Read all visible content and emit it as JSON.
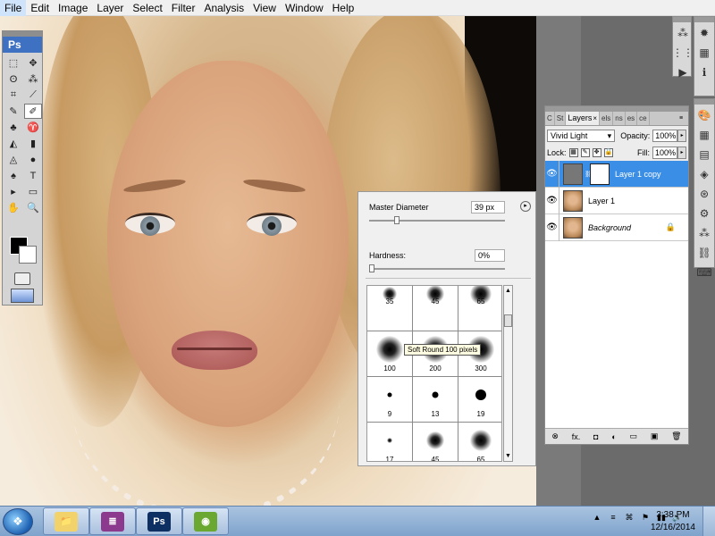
{
  "menu": [
    "File",
    "Edit",
    "Image",
    "Layer",
    "Select",
    "Filter",
    "Analysis",
    "View",
    "Window",
    "Help"
  ],
  "tools": {
    "logo": "Ps",
    "panel_grip": "◂◂",
    "rows": [
      [
        "⬚",
        "✥"
      ],
      [
        "ʘ",
        "⁂"
      ],
      [
        "⌗",
        "⟋"
      ],
      [
        "✎",
        "✐"
      ],
      [
        "♣",
        "♈"
      ],
      [
        "◭",
        "▮"
      ],
      [
        "◬",
        "●"
      ],
      [
        "♠",
        "T"
      ],
      [
        "▸",
        "▭"
      ],
      [
        "✋",
        "🔍"
      ]
    ],
    "icon_names": [
      "marquee-tool-icon",
      "move-tool-icon",
      "lasso-tool-icon",
      "magic-wand-icon",
      "crop-tool-icon",
      "eyedropper-icon",
      "healing-brush-icon",
      "brush-tool-icon",
      "clone-stamp-icon",
      "history-brush-icon",
      "eraser-icon",
      "gradient-tool-icon",
      "blur-tool-icon",
      "dodge-tool-icon",
      "pen-tool-icon",
      "type-tool-icon",
      "path-select-icon",
      "shape-tool-icon",
      "hand-tool-icon",
      "zoom-tool-icon"
    ]
  },
  "brush_picker": {
    "master_diameter_label": "Master Diameter",
    "master_diameter_value": "39 px",
    "hardness_label": "Hardness:",
    "hardness_value": "0%",
    "menu_glyph": "▸",
    "scroll_up": "▲",
    "scroll_down": "▼",
    "presets": [
      {
        "size": "35",
        "soft": true,
        "d": 16
      },
      {
        "size": "45",
        "soft": true,
        "d": 20
      },
      {
        "size": "65",
        "soft": true,
        "d": 24
      },
      {
        "size": "100",
        "soft": true,
        "d": 30
      },
      {
        "size": "200",
        "soft": true,
        "d": 30
      },
      {
        "size": "300",
        "soft": true,
        "d": 30
      },
      {
        "size": "9",
        "soft": false,
        "d": 5
      },
      {
        "size": "13",
        "soft": false,
        "d": 7
      },
      {
        "size": "19",
        "soft": false,
        "d": 12
      },
      {
        "size": "17",
        "soft": true,
        "d": 6
      },
      {
        "size": "45",
        "soft": true,
        "d": 20
      },
      {
        "size": "65",
        "soft": true,
        "d": 24
      }
    ],
    "tooltip": "Soft Round 100 pixels"
  },
  "layers_panel": {
    "grip": "◂◂",
    "tabs": [
      {
        "label": "C",
        "active": false
      },
      {
        "label": "St",
        "active": false
      },
      {
        "label": "Layers",
        "active": true
      },
      {
        "label": "els",
        "active": false
      },
      {
        "label": "ns",
        "active": false
      },
      {
        "label": "es",
        "active": false
      },
      {
        "label": "ce",
        "active": false
      }
    ],
    "tab_close": "×",
    "blend_mode": "Vivid Light",
    "opacity_label": "Opacity:",
    "opacity_value": "100%",
    "lock_label": "Lock:",
    "fill_label": "Fill:",
    "fill_value": "100%",
    "layers": [
      {
        "name": "Layer 1 copy",
        "selected": true,
        "mask": true,
        "italic": false,
        "locked": false
      },
      {
        "name": "Layer 1",
        "selected": false,
        "mask": false,
        "italic": false,
        "locked": false
      },
      {
        "name": "Background",
        "selected": false,
        "mask": false,
        "italic": true,
        "locked": true
      }
    ],
    "footer_icons": [
      "⊗",
      "fx.",
      "◘",
      "◐",
      "▭",
      "▣",
      "🗑"
    ]
  },
  "dock1": {
    "buttons": [
      "⁂",
      "⋮⋮",
      "▶"
    ]
  },
  "dock2": {
    "buttons": [
      "✹",
      "▦",
      "ℹ"
    ]
  },
  "dock3": {
    "buttons": [
      "🎨",
      "▦",
      "▤",
      "◈",
      "⊛",
      "⚙",
      "⁂",
      "⛓",
      "⌨"
    ]
  },
  "taskbar": {
    "start_glyph": "❖",
    "apps": [
      {
        "name": "explorer",
        "glyph": "📁",
        "bg": "#f2d26b"
      },
      {
        "name": "winrar",
        "glyph": "≣",
        "bg": "#8b3a8d"
      },
      {
        "name": "photoshop",
        "glyph": "Ps",
        "bg": "#0e2f62"
      },
      {
        "name": "app4",
        "glyph": "◉",
        "bg": "#6aa832"
      }
    ],
    "tray": [
      "▲",
      "≡",
      "⌘",
      "⚑",
      "▮▮",
      "🔊"
    ],
    "time": "3:38 PM",
    "date": "12/16/2014"
  }
}
